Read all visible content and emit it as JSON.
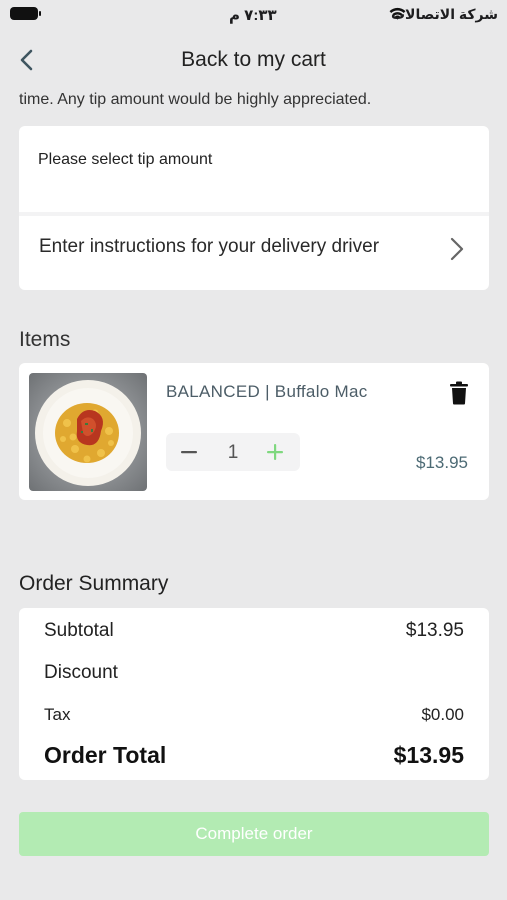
{
  "status_bar": {
    "carrier": "شركة الاتصالات",
    "time": "٧:٣٣ م"
  },
  "header": {
    "title": "Back to my cart",
    "back_icon": "chevron-left-icon"
  },
  "tip": {
    "note": "time. Any tip amount would be highly appreciated.",
    "select_label": "Please select tip amount",
    "instructions_label": "Enter instructions for your delivery driver"
  },
  "items_section": {
    "title": "Items",
    "items": [
      {
        "name": "BALANCED | Buffalo Mac",
        "quantity": "1",
        "price": "$13.95",
        "image": "buffalo-mac-food-photo"
      }
    ]
  },
  "summary": {
    "title": "Order Summary",
    "subtotal_label": "Subtotal",
    "subtotal_value": "$13.95",
    "discount_label": "Discount",
    "discount_value": "",
    "tax_label": "Tax",
    "tax_value": "$0.00",
    "total_label": "Order Total",
    "total_value": "$13.95"
  },
  "actions": {
    "complete_label": "Complete order"
  },
  "colors": {
    "background": "#e9e9ea",
    "card": "#ffffff",
    "accent_green": "#7fd87f",
    "button_disabled_green": "#b3ebb3",
    "price_teal": "#4c6a74"
  }
}
